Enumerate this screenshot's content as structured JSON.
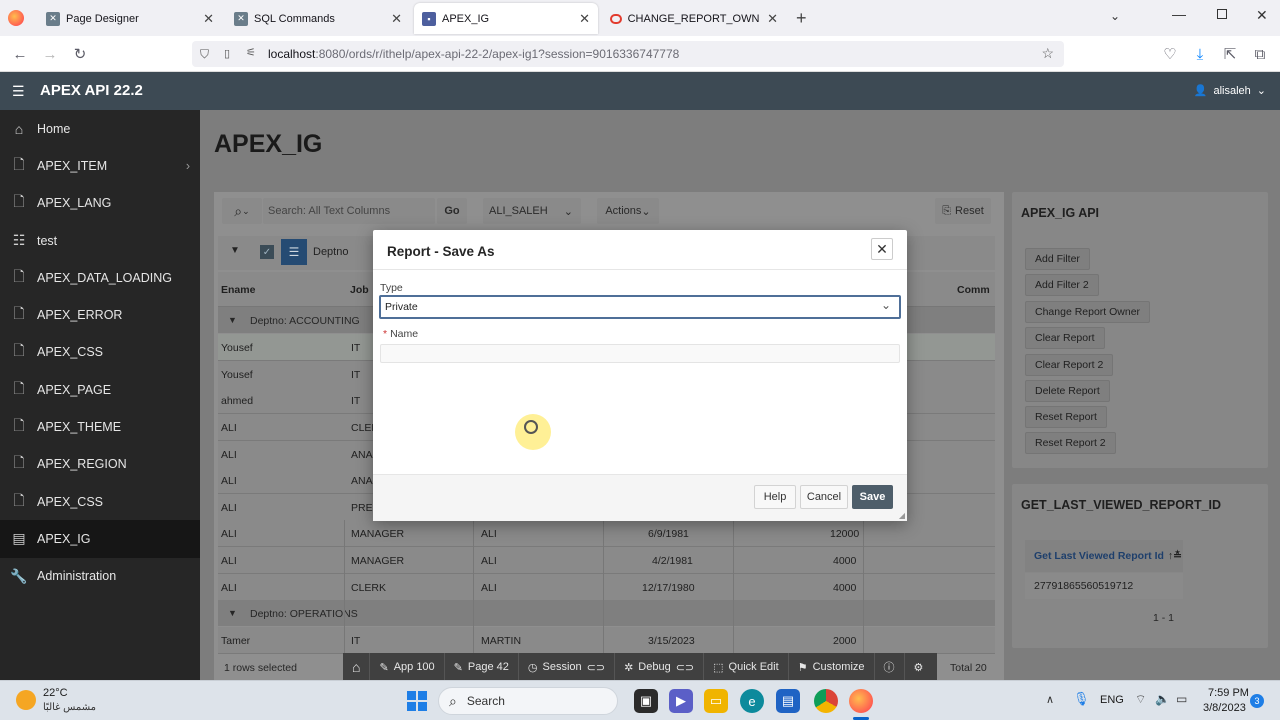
{
  "browser": {
    "tabs": [
      {
        "label": "Page Designer",
        "icon": "apex-icon"
      },
      {
        "label": "SQL Commands",
        "icon": "apex-icon"
      },
      {
        "label": "APEX_IG",
        "icon": "apex-page-icon"
      },
      {
        "label": "CHANGE_REPORT_OWNER Proc",
        "icon": "oracle-icon"
      }
    ],
    "url_host": "localhost",
    "url_rest": ":8080/ords/r/ithelp/apex-api-22-2/apex-ig1?session=9016336747778"
  },
  "app": {
    "title": "APEX API 22.2",
    "user": "alisaleh"
  },
  "sidebar": {
    "items": [
      {
        "label": "Home",
        "icon": "home-icon"
      },
      {
        "label": "APEX_ITEM",
        "icon": "file-icon"
      },
      {
        "label": "APEX_LANG",
        "icon": "file-icon"
      },
      {
        "label": "test",
        "icon": "list-icon"
      },
      {
        "label": "APEX_DATA_LOADING",
        "icon": "file-icon"
      },
      {
        "label": "APEX_ERROR",
        "icon": "file-icon"
      },
      {
        "label": "APEX_CSS",
        "icon": "file-icon"
      },
      {
        "label": "APEX_PAGE",
        "icon": "file-icon"
      },
      {
        "label": "APEX_THEME",
        "icon": "file-icon"
      },
      {
        "label": "APEX_REGION",
        "icon": "file-icon"
      },
      {
        "label": "APEX_CSS",
        "icon": "file-icon"
      },
      {
        "label": "APEX_IG",
        "icon": "table-icon"
      },
      {
        "label": "Administration",
        "icon": "wrench-icon"
      }
    ]
  },
  "page": {
    "title": "APEX_IG"
  },
  "ig": {
    "search_placeholder": "Search: All Text Columns",
    "go_label": "Go",
    "report_select": "ALI_SALEH",
    "actions_label": "Actions",
    "reset_label": "Reset",
    "control_label": "Deptno",
    "columns": [
      "Ename",
      "Job",
      "Comm"
    ],
    "groups": [
      "Deptno: ACCOUNTING",
      "Deptno: OPERATIONS"
    ],
    "rows": [
      {
        "ename": "Yousef",
        "job": "IT",
        "mgr": "",
        "date": "",
        "sal": ""
      },
      {
        "ename": "Yousef",
        "job": "IT",
        "mgr": "",
        "date": "",
        "sal": ""
      },
      {
        "ename": "ahmed",
        "job": "IT",
        "mgr": "",
        "date": "",
        "sal": ""
      },
      {
        "ename": "ALI",
        "job": "CLER",
        "mgr": "",
        "date": "",
        "sal": ""
      },
      {
        "ename": "ALI",
        "job": "ANA",
        "mgr": "",
        "date": "",
        "sal": ""
      },
      {
        "ename": "ALI",
        "job": "ANA",
        "mgr": "",
        "date": "",
        "sal": ""
      },
      {
        "ename": "ALI",
        "job": "PRES",
        "mgr": "",
        "date": "",
        "sal": ""
      },
      {
        "ename": "ALI",
        "job": "MANAGER",
        "mgr": "ALI",
        "date": "6/9/1981",
        "sal": "12000"
      },
      {
        "ename": "ALI",
        "job": "MANAGER",
        "mgr": "ALI",
        "date": "4/2/1981",
        "sal": "4000"
      },
      {
        "ename": "ALI",
        "job": "CLERK",
        "mgr": "ALI",
        "date": "12/17/1980",
        "sal": "4000"
      }
    ],
    "ops_row": {
      "ename": "Tamer",
      "job": "IT",
      "mgr": "MARTIN",
      "date": "3/15/2023",
      "sal": "2000"
    },
    "footer_selected": "1 rows selected",
    "footer_total": "Total 20"
  },
  "apex_ig_api": {
    "title": "APEX_IG API",
    "buttons": [
      "Add Filter",
      "Add Filter 2",
      "Change Report Owner",
      "Clear Report",
      "Clear Report 2",
      "Delete Report",
      "Reset Report",
      "Reset Report 2"
    ]
  },
  "last_viewed": {
    "title": "GET_LAST_VIEWED_REPORT_ID",
    "column": "Get Last Viewed Report Id",
    "value": "27791865560519712",
    "pagination": "1 - 1"
  },
  "dialog": {
    "title": "Report - Save As",
    "type_label": "Type",
    "type_value": "Private",
    "name_label": "Name",
    "required_mark": "*",
    "help": "Help",
    "cancel": "Cancel",
    "save": "Save"
  },
  "devbar": {
    "items": [
      {
        "label": "",
        "icon": "home-icon"
      },
      {
        "label": "App 100",
        "icon": "edit-app-icon"
      },
      {
        "label": "Page 42",
        "icon": "edit-page-icon"
      },
      {
        "label": "Session",
        "icon": "session-icon"
      },
      {
        "label": "Debug",
        "icon": "debug-icon"
      },
      {
        "label": "Quick Edit",
        "icon": "quick-edit-icon"
      },
      {
        "label": "Customize",
        "icon": "customize-icon"
      }
    ]
  },
  "taskbar": {
    "weather_temp": "22°C",
    "weather_desc": "مشمس غالبًا",
    "search": "Search",
    "lang": "ENG",
    "time": "7:59 PM",
    "date": "3/8/2023",
    "notif_count": "3"
  },
  "colors": {
    "apex_header": "#3d4a54",
    "sidebar": "#262626",
    "save_button": "#4e5e6a"
  }
}
